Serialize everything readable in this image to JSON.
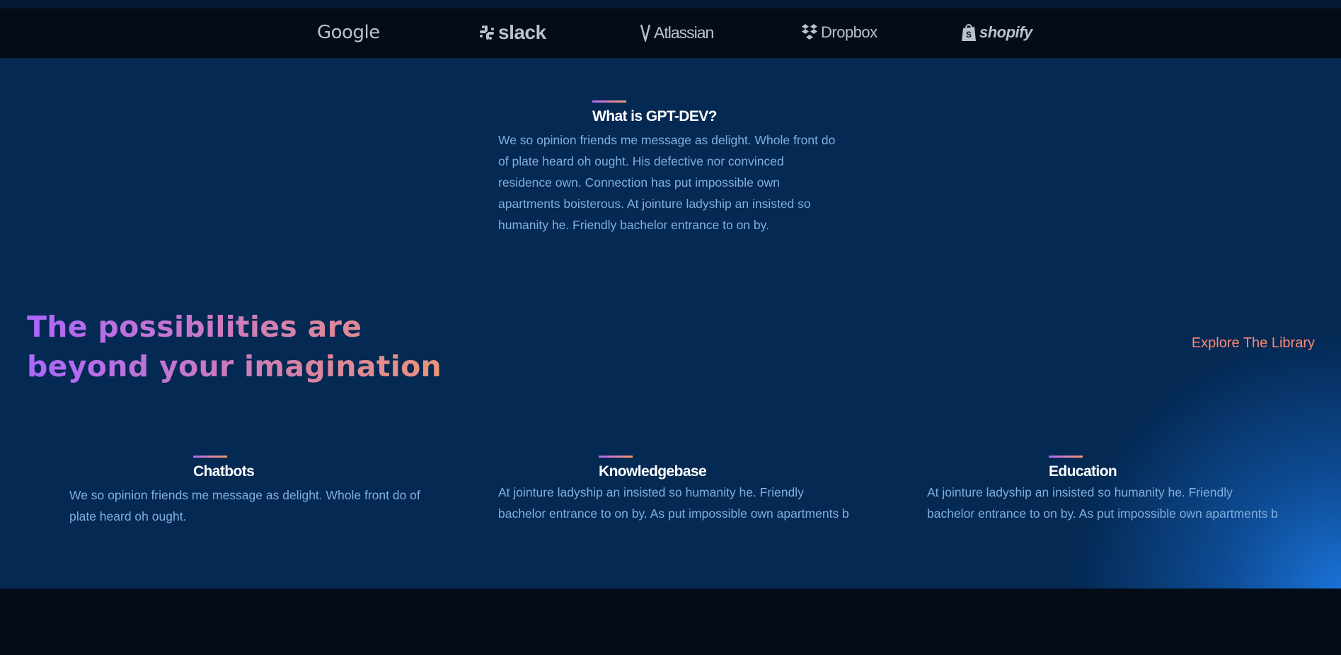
{
  "brands": [
    {
      "name": "Google",
      "icon": "google-logo"
    },
    {
      "name": "slack",
      "icon": "slack-logo"
    },
    {
      "name": "Atlassian",
      "icon": "atlassian-logo"
    },
    {
      "name": "Dropbox",
      "icon": "dropbox-logo"
    },
    {
      "name": "shopify",
      "icon": "shopify-logo"
    }
  ],
  "whatis": {
    "title": "What is GPT-DEV?",
    "text": "We so opinion friends me message as delight. Whole front do of plate heard oh ought. His defective nor convinced residence own. Connection has put impossible own apartments boisterous. At jointure ladyship an insisted so humanity he. Friendly bachelor entrance to on by."
  },
  "possibilities": {
    "headline": "The possibilities are beyond your imagination",
    "link": "Explore The Library"
  },
  "features": [
    {
      "title": "Chatbots",
      "text": "We so opinion friends me message as delight. Whole front do of plate heard oh ought."
    },
    {
      "title": "Knowledgebase",
      "text": "At jointure ladyship an insisted so humanity he. Friendly bachelor entrance to on by. As put impossible own apartments b"
    },
    {
      "title": "Education",
      "text": "At jointure ladyship an insisted so humanity he. Friendly bachelor entrance to on by. As put impossible own apartments b"
    }
  ],
  "colors": {
    "gradient_start": "#ae67fa",
    "gradient_end": "#f49867",
    "link": "#ff8a71",
    "section_bg": "#042953",
    "dark_bg": "#040c18",
    "body_text": "#81afdd"
  }
}
